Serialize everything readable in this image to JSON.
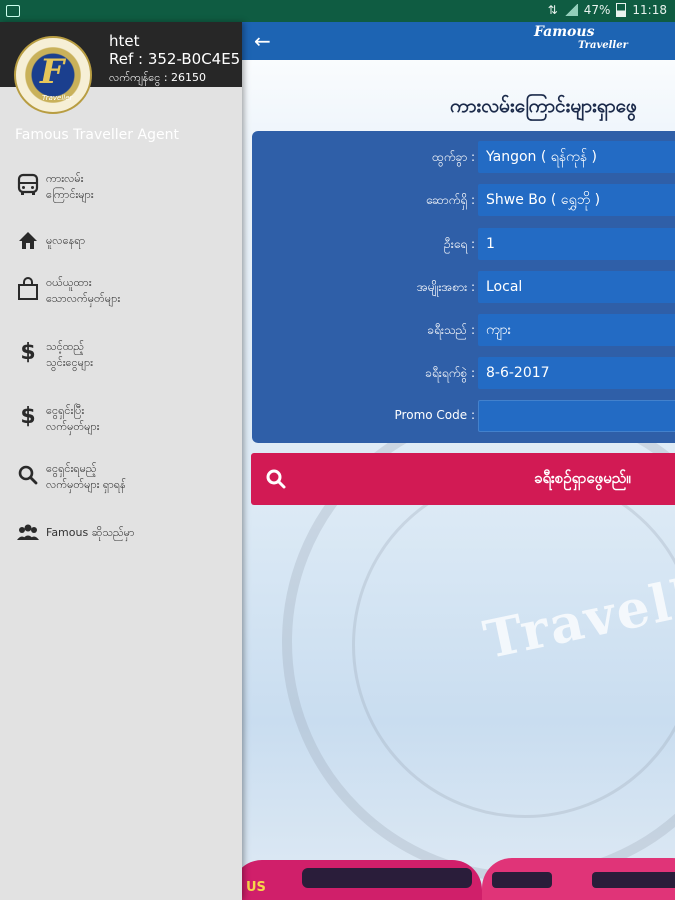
{
  "status_bar": {
    "battery": "47%",
    "time": "11:18"
  },
  "toolbar": {
    "brand_line1": "Famous",
    "brand_line2": "Traveller"
  },
  "drawer": {
    "logo_letter": "F",
    "logo_sub": "Traveller",
    "user_name": "htet",
    "user_ref": "Ref : 352-B0C4E5",
    "user_balance": "လက်ကျန်ငွေ : 26150",
    "agent_title": "Famous Traveller Agent",
    "menu": [
      {
        "icon": "bus-icon",
        "line1": "ကားလမ်း",
        "line2": "ကြောင်းများ"
      },
      {
        "icon": "home-icon",
        "line1": "မူလနေရာ",
        "line2": ""
      },
      {
        "icon": "shopping-bag-icon",
        "line1": "ဝယ်ယူထား",
        "line2": "သောလက်မှတ်များ"
      },
      {
        "icon": "dollar-icon",
        "line1": "သင့်ထည့်",
        "line2": "သွင်းငွေများ"
      },
      {
        "icon": "dollar-icon",
        "line1": "ငွေရှင်းပြီး",
        "line2": "လက်မှတ်များ"
      },
      {
        "icon": "search-icon",
        "line1": "ငွေရှင်းရမည့်",
        "line2": "လက်မှတ်များ ရှာရန်"
      },
      {
        "icon": "group-icon",
        "line1": "Famous ဆိုသည်မှာ",
        "line2": ""
      }
    ]
  },
  "main": {
    "page_title": "ကားလမ်းကြောင်းများရှာဖွေ",
    "form": {
      "from_label": "ထွက်ခွာ :",
      "from_value": "Yangon ( ရန်ကုန် )",
      "to_label": "ဆောက်ရှိ :",
      "to_value": "Shwe Bo ( ရွှေဘို )",
      "seats_label": "ဦးရေ :",
      "seats_value": "1",
      "nationality_label": "အမျိုးအစား :",
      "nationality_value": "Local",
      "route_label": "ခရီးသည် :",
      "route_value": "ကျား",
      "date_label": "ခရီးရက်စွဲ :",
      "date_value": "8-6-2017",
      "promo_label": "Promo Code :",
      "promo_value": ""
    },
    "search_button": "ခရီးစဉ်ရှာဖွေမည်။",
    "watermark_text": "Traveller",
    "bus_logo_text": "US"
  }
}
